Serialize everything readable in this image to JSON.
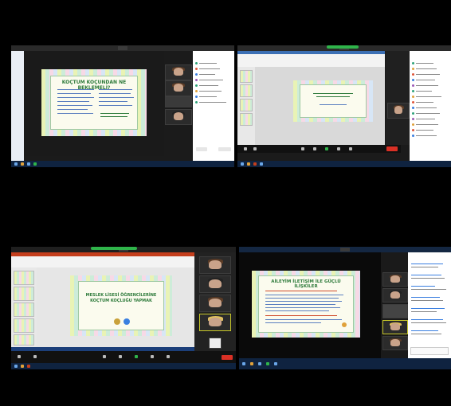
{
  "screens": [
    {
      "window_title": "",
      "slide_title": "KOÇTUM KOÇUNDAN NE BEKLEMELİ?",
      "participants_title": "",
      "speaker_name": "",
      "clock": ""
    },
    {
      "window_title": "",
      "slide_title": "",
      "participants_title": "",
      "clock": ""
    },
    {
      "window_title": "",
      "slide_title": "MESLEK LİSESİ ÖĞRENCİLERİNE KOÇTUM KOÇLUĞU YAPMAK",
      "speaker_name": "",
      "clock": ""
    },
    {
      "window_title": "",
      "slide_title": "AİLEYİM İLETİŞİM İLE GÜÇLÜ İLİŞKİLER",
      "chat_title": "",
      "clock": ""
    }
  ],
  "colors": {
    "background": "#000000",
    "taskbar": "#0f2340",
    "slide_green": "#2d7a3a",
    "end_button": "#d93025",
    "ppt_red": "#c43e1c",
    "zoom_green": "#2fb44a"
  },
  "icons": [
    "window-icon",
    "participant-avatar-icon",
    "end-meeting-icon",
    "taskbar-app-icon"
  ]
}
